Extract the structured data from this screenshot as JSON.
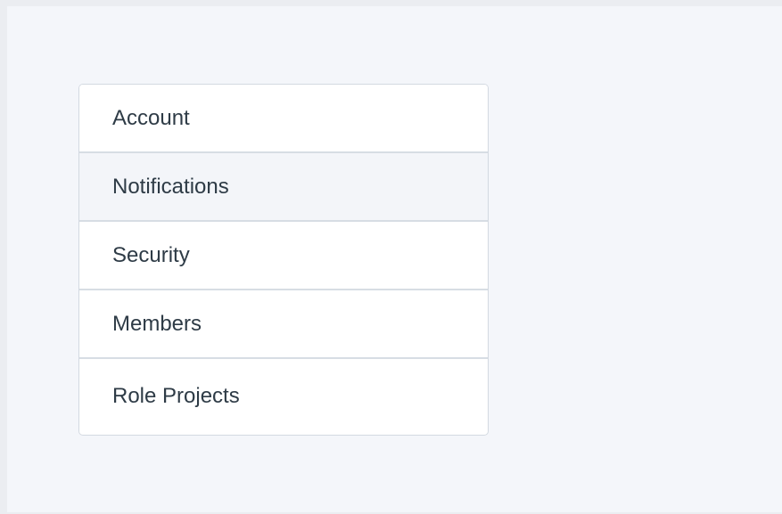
{
  "settings_menu": {
    "items": [
      {
        "label": "Account",
        "selected": false
      },
      {
        "label": "Notifications",
        "selected": true
      },
      {
        "label": "Security",
        "selected": false
      },
      {
        "label": "Members",
        "selected": false
      },
      {
        "label": "Role Projects",
        "selected": false
      }
    ]
  },
  "colors": {
    "page_background": "#f4f6fa",
    "outer_border": "#ebedf1",
    "item_background": "#ffffff",
    "selected_item_background": "#f3f5f9",
    "divider": "#d7dde4",
    "text": "#2e3b46"
  }
}
